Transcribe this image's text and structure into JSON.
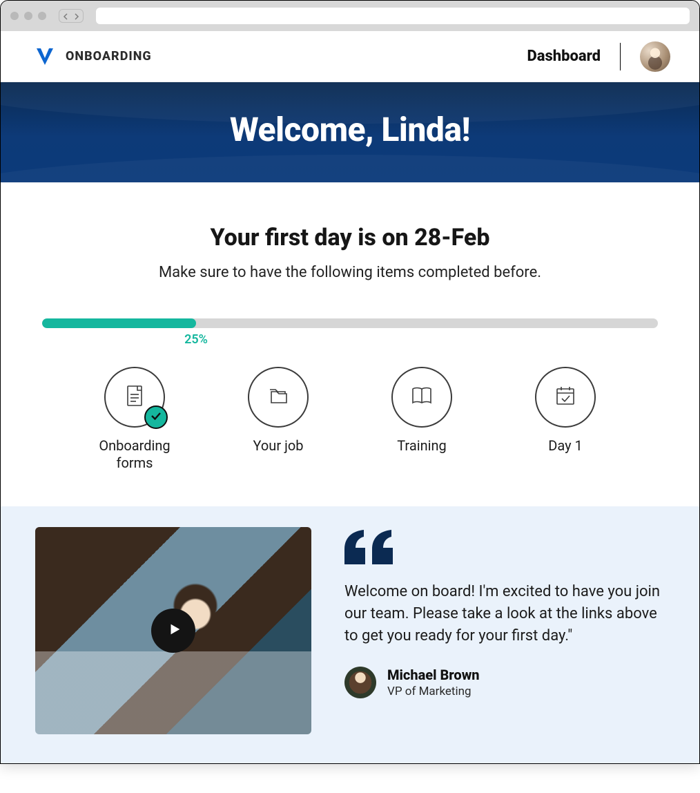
{
  "brand": {
    "app_name": "ONBOARDING"
  },
  "topbar": {
    "dashboard_label": "Dashboard"
  },
  "hero": {
    "welcome": "Welcome, Linda!"
  },
  "first_day": {
    "heading": "Your first day is on 28-Feb",
    "subtext": "Make sure to have the following items completed before."
  },
  "progress": {
    "percent": 25,
    "percent_label": "25%"
  },
  "steps": [
    {
      "label": "Onboarding\nforms",
      "completed": true
    },
    {
      "label": "Your job",
      "completed": false
    },
    {
      "label": "Training",
      "completed": false
    },
    {
      "label": "Day 1",
      "completed": false
    }
  ],
  "quote": {
    "text": "Welcome on board! I'm excited to have you join our team. Please take a look at the links above to get you ready for your first day.\"",
    "author_name": "Michael Brown",
    "author_title": "VP of Marketing"
  }
}
